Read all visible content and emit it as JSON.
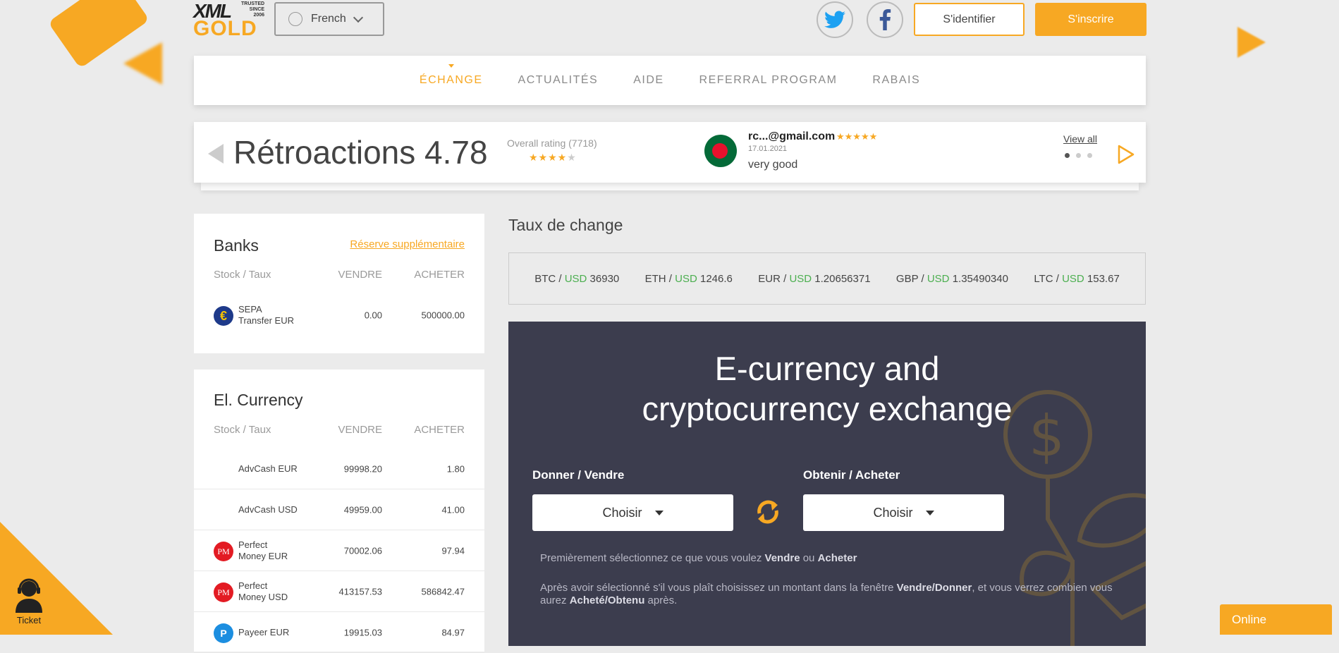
{
  "header": {
    "logo": {
      "line1": "XML",
      "line2": "GOLD",
      "trusted": "TRUSTED\nSINCE\n2006"
    },
    "language": "French",
    "login": "S'identifier",
    "signup": "S'inscrire"
  },
  "nav": [
    {
      "label": "ÉCHANGE",
      "active": true
    },
    {
      "label": "ACTUALITÉS",
      "active": false
    },
    {
      "label": "AIDE",
      "active": false
    },
    {
      "label": "REFERRAL PROGRAM",
      "active": false
    },
    {
      "label": "RABAIS",
      "active": false
    }
  ],
  "feedback": {
    "title": "Rétroactions 4.78",
    "overall": "Overall rating (7718)",
    "overall_stars": 4,
    "review": {
      "email": "rc...@gmail.com",
      "stars": "★★★★★",
      "date": "17.01.2021",
      "text": "very good"
    },
    "view_all": "View all"
  },
  "banks": {
    "title": "Banks",
    "reserve_link": "Réserve supplémentaire",
    "headers": {
      "name": "Stock / Taux",
      "sell": "VENDRE",
      "buy": "ACHETER"
    },
    "rows": [
      {
        "name_line1": "SEPA",
        "name_line2": "Transfer EUR",
        "sell": "0.00",
        "buy": "500000.00"
      }
    ]
  },
  "ecurrency": {
    "title": "El. Currency",
    "headers": {
      "name": "Stock / Taux",
      "sell": "VENDRE",
      "buy": "ACHETER"
    },
    "rows": [
      {
        "name_line1": "AdvCash EUR",
        "name_line2": "",
        "sell": "99998.20",
        "buy": "1.80"
      },
      {
        "name_line1": "AdvCash USD",
        "name_line2": "",
        "sell": "49959.00",
        "buy": "41.00"
      },
      {
        "name_line1": "Perfect",
        "name_line2": "Money EUR",
        "sell": "70002.06",
        "buy": "97.94"
      },
      {
        "name_line1": "Perfect",
        "name_line2": "Money USD",
        "sell": "413157.53",
        "buy": "586842.47"
      },
      {
        "name_line1": "Payeer EUR",
        "name_line2": "",
        "sell": "19915.03",
        "buy": "84.97"
      }
    ]
  },
  "rates": {
    "title": "Taux de change",
    "items": [
      {
        "base": "BTC",
        "quote": "USD",
        "value": "36930"
      },
      {
        "base": "ETH",
        "quote": "USD",
        "value": "1246.6"
      },
      {
        "base": "EUR",
        "quote": "USD",
        "value": "1.20656371"
      },
      {
        "base": "GBP",
        "quote": "USD",
        "value": "1.35490340"
      },
      {
        "base": "LTC",
        "quote": "USD",
        "value": "153.67"
      }
    ]
  },
  "exchange": {
    "title_line1": "E-currency and",
    "title_line2": "cryptocurrency exchange",
    "give_label": "Donner / Vendre",
    "get_label": "Obtenir / Acheter",
    "choose": "Choisir",
    "info1": {
      "pre": "Premièrement sélectionnez ce que vous voulez ",
      "b1": "Vendre",
      "mid": " ou ",
      "b2": "Acheter"
    },
    "info2": {
      "pre": "Après avoir sélectionné s'il vous plaît choisissez un montant dans la fenêtre ",
      "b1": "Vendre/Donner",
      "mid": ", et vous verrez combien vous aurez ",
      "b2": "Acheté/Obtenu",
      "post": " après."
    }
  },
  "ticket_label": "Ticket",
  "online_label": "Online",
  "colors": {
    "accent": "#f7a823",
    "dark_panel": "#3c3d4e",
    "usd_green": "#4caf50"
  }
}
